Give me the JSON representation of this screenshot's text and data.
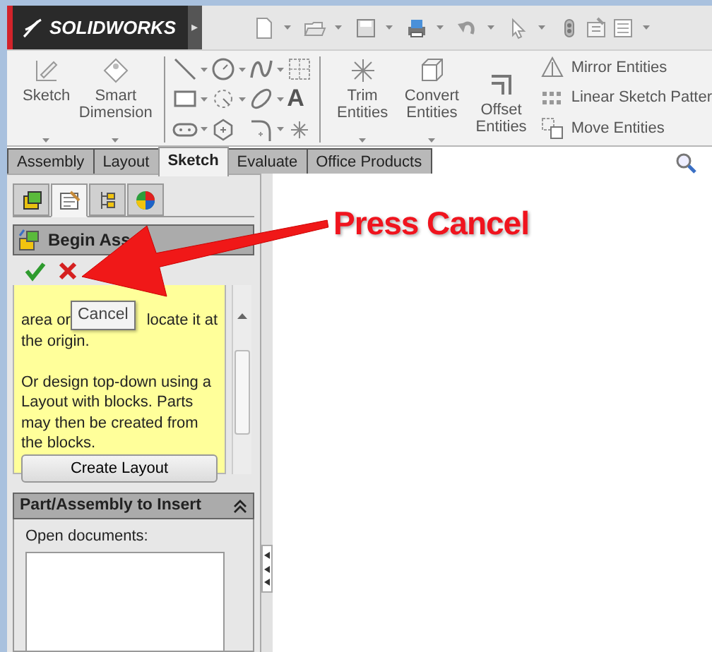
{
  "app": {
    "logo": "SOLIDWORKS",
    "flyout": "▸"
  },
  "ribbon": {
    "left_commands": [
      {
        "label": "Sketch",
        "dropdown": true
      },
      {
        "label": "Smart Dimension",
        "dropdown": true
      }
    ],
    "text_tool_glyph": "A",
    "entity_commands": [
      {
        "label": "Trim Entities",
        "dropdown": true
      },
      {
        "label": "Convert Entities",
        "dropdown": true
      },
      {
        "label": "Offset Entities",
        "dropdown": false
      }
    ],
    "small_commands": [
      {
        "label": "Mirror Entities"
      },
      {
        "label": "Linear Sketch Patter"
      },
      {
        "label": "Move Entities"
      }
    ]
  },
  "command_tabs": [
    {
      "label": "Assembly",
      "selected": false
    },
    {
      "label": "Layout",
      "selected": false
    },
    {
      "label": "Sketch",
      "selected": true
    },
    {
      "label": "Evaluate",
      "selected": false
    },
    {
      "label": "Office Products",
      "selected": false
    }
  ],
  "property_panel": {
    "tabs": [
      {
        "selected": false
      },
      {
        "selected": true
      },
      {
        "selected": false
      },
      {
        "selected": false
      }
    ],
    "title": "Begin Ass",
    "message": {
      "line_1_left": "area or",
      "line_1_right": "locate it at",
      "line_2": "the origin.",
      "paragraph_2": "Or design top-down using a Layout with blocks. Parts may then be created from the blocks."
    },
    "button": "Create Layout",
    "section": {
      "title": "Part/Assembly to Insert",
      "expanded": true,
      "field_label": "Open documents:"
    }
  },
  "tooltip": "Cancel",
  "annotation": "Press Cancel"
}
